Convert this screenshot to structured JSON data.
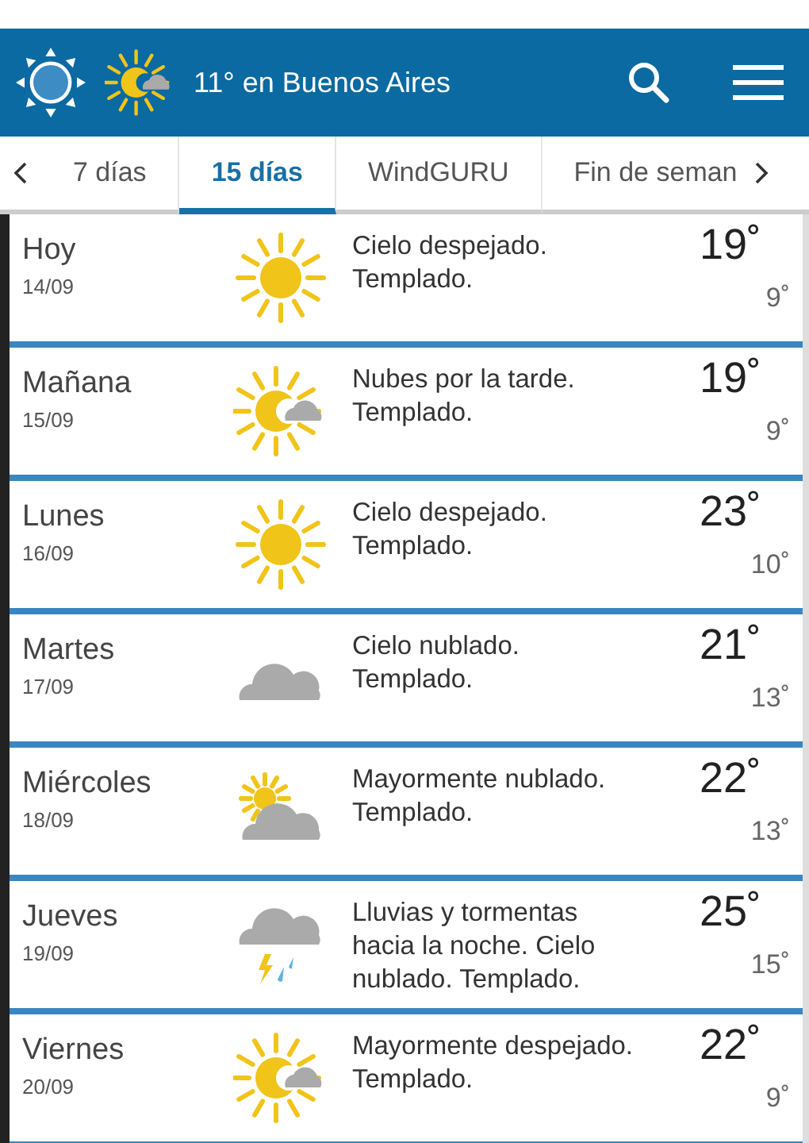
{
  "header": {
    "title": "11° en Buenos Aires"
  },
  "tabs": [
    {
      "label": "7 días",
      "selected": false
    },
    {
      "label": "15 días",
      "selected": true
    },
    {
      "label": "WindGURU",
      "selected": false
    },
    {
      "label": "Fin de seman",
      "selected": false
    }
  ],
  "days": [
    {
      "day": "Hoy",
      "date": "14/09",
      "kind": "sunny",
      "description": "Cielo despejado. Templado.",
      "high": "19˚",
      "low": "9˚"
    },
    {
      "day": "Mañana",
      "date": "15/09",
      "kind": "partly",
      "description": "Nubes por la tarde. Templado.",
      "high": "19˚",
      "low": "9˚"
    },
    {
      "day": "Lunes",
      "date": "16/09",
      "kind": "sunny",
      "description": "Cielo despejado. Templado.",
      "high": "23˚",
      "low": "10˚"
    },
    {
      "day": "Martes",
      "date": "17/09",
      "kind": "cloudy",
      "description": "Cielo nublado. Templado.",
      "high": "21˚",
      "low": "13˚"
    },
    {
      "day": "Miércoles",
      "date": "18/09",
      "kind": "mostly-cloudy",
      "description": "Mayormente nublado. Templado.",
      "high": "22˚",
      "low": "13˚"
    },
    {
      "day": "Jueves",
      "date": "19/09",
      "kind": "storm",
      "description": "Lluvias y tormentas hacia la noche. Cielo nublado. Templado.",
      "high": "25˚",
      "low": "15˚"
    },
    {
      "day": "Viernes",
      "date": "20/09",
      "kind": "partly",
      "description": "Mayormente despejado. Templado.",
      "high": "22˚",
      "low": "9˚"
    }
  ]
}
